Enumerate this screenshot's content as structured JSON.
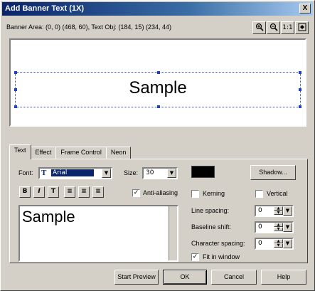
{
  "window": {
    "title": "Add Banner Text (1X)",
    "close_glyph": "X"
  },
  "info": {
    "text": "Banner Area: (0, 0) (468, 60), Text Obj: (184, 15) (234, 44)"
  },
  "zoom_buttons": [
    {
      "icon": "zoom-in-icon",
      "glyph": "🔍"
    },
    {
      "icon": "zoom-out-icon",
      "glyph": "🔍"
    },
    {
      "icon": "actual-size-icon",
      "label": "1:1"
    },
    {
      "icon": "fit-window-icon",
      "glyph": "⛶"
    }
  ],
  "preview": {
    "text": "Sample"
  },
  "tabs": [
    {
      "label": "Text",
      "active": true
    },
    {
      "label": "Effect",
      "active": false
    },
    {
      "label": "Frame Control",
      "active": false
    },
    {
      "label": "Neon",
      "active": false
    }
  ],
  "text_tab": {
    "font_label": "Font:",
    "font_value": "Arial",
    "font_icon": "T",
    "size_label": "Size:",
    "size_value": "30",
    "shadow_button": "Shadow...",
    "format_buttons": [
      {
        "name": "bold-button",
        "glyph": "B"
      },
      {
        "name": "italic-button",
        "glyph": "I"
      },
      {
        "name": "outline-button",
        "glyph": "T"
      },
      {
        "name": "align-left-button",
        "glyph": "≡"
      },
      {
        "name": "align-center-button",
        "glyph": "≡"
      },
      {
        "name": "align-right-button",
        "glyph": "≡"
      }
    ],
    "anti_aliasing": {
      "label": "Anti-aliasing",
      "checked": true
    },
    "kerning": {
      "label": "Kerning",
      "checked": false
    },
    "vertical": {
      "label": "Vertical",
      "checked": false
    },
    "line_spacing": {
      "label": "Line spacing:",
      "value": "0"
    },
    "baseline_shift": {
      "label": "Baseline shift:",
      "value": "0"
    },
    "character_spacing": {
      "label": "Character spacing:",
      "value": "0"
    },
    "fit_in_window": {
      "label": "Fit in window",
      "checked": true
    },
    "text_value": "Sample",
    "text_color": "#000000"
  },
  "footer": {
    "start_preview": "Start Preview",
    "ok": "OK",
    "cancel": "Cancel",
    "help": "Help"
  },
  "check_glyph": "✓",
  "arrow_down_glyph": "▼",
  "arrow_up_glyph": "▲"
}
